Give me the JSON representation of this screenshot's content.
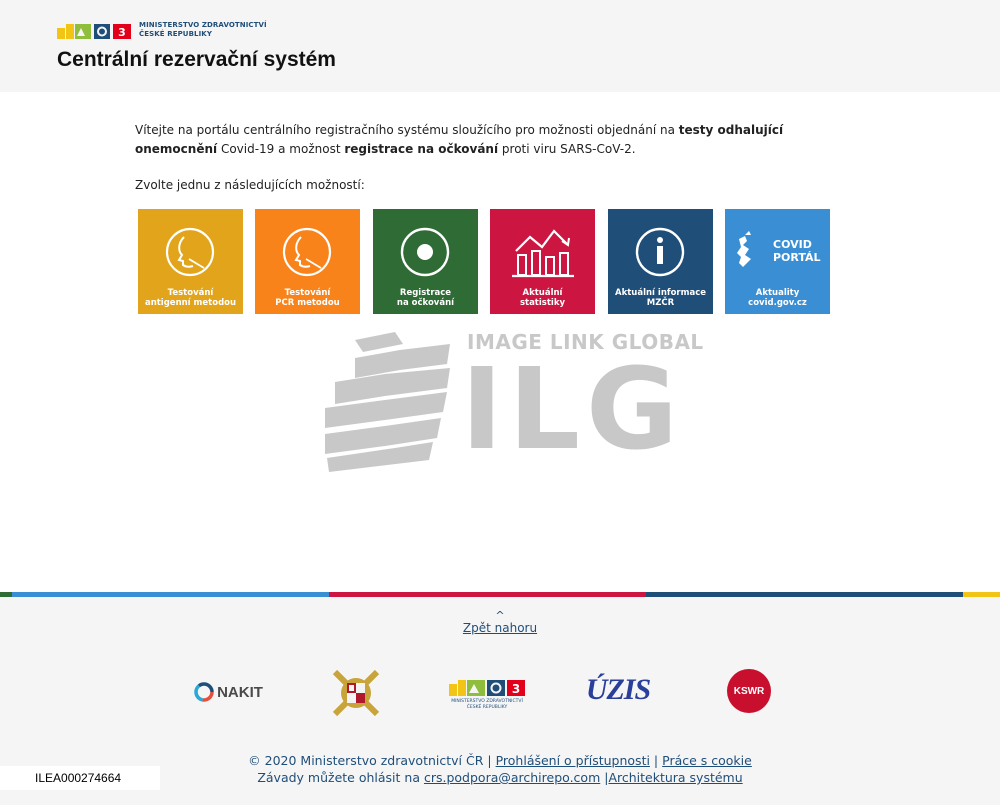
{
  "header": {
    "ministry_name_line1": "MINISTERSTVO ZDRAVOTNICTVÍ",
    "ministry_name_line2": "ČESKÉ REPUBLIKY",
    "title": "Centrální rezervační systém",
    "logo_colors": [
      "#f2c416",
      "#8fbe3c",
      "#1f4e79",
      "#e2001a"
    ]
  },
  "main": {
    "intro_part1": "Vítejte na portálu centrálního registračního systému sloužícího pro možnosti objednání na ",
    "intro_bold1": "testy odhalující onemocnění",
    "intro_part2": " Covid-19 a možnost ",
    "intro_bold2": "registrace na očkování",
    "intro_part3": " proti viru SARS-CoV-2.",
    "choose_text": "Zvolte jednu z následujících možností:",
    "tiles": [
      {
        "label": "Testování\nantigenní metodou",
        "color": "#e2a41b",
        "icon": "face-swab-icon"
      },
      {
        "label": "Testování\nPCR metodou",
        "color": "#f7831a",
        "icon": "face-swab-icon"
      },
      {
        "label": "Registrace\nna očkování",
        "color": "#2e6b35",
        "icon": "target-circle-icon"
      },
      {
        "label": "Aktuální\nstatistiky",
        "color": "#cc1641",
        "icon": "bar-chart-icon"
      },
      {
        "label": "Aktuální informace\nMZČR",
        "color": "#1f4e79",
        "icon": "info-icon"
      },
      {
        "label": "Aktuality\ncovid.gov.cz",
        "color": "#3a8fd4",
        "icon": "covid-portal-icon",
        "badge_line1": "COVID",
        "badge_line2": "PORTÁL"
      }
    ]
  },
  "watermark": {
    "top_text": "IMAGE LINK GLOBAL",
    "big_text": "ILG"
  },
  "footer": {
    "stripe_colors": [
      "#3a8fd4",
      "#cc1641",
      "#1f4e79",
      "#f2c416"
    ],
    "back_to_top": "Zpět nahoru",
    "partners": {
      "nakit": "NAKIT",
      "uzis": "ÚZIS",
      "ksrr": "KSWR"
    },
    "copyright": "© 2020 Ministerstvo zdravotnictví ČR",
    "accessibility_link": "Prohlášení o přístupnosti",
    "cookies_link": "Práce s cookie",
    "report_text": "Závady můžete ohlásit na",
    "email_link": "crs.podpora@archirepo.com",
    "architecture_link": "Architektura systému"
  },
  "image_code": "ILEA000274664"
}
